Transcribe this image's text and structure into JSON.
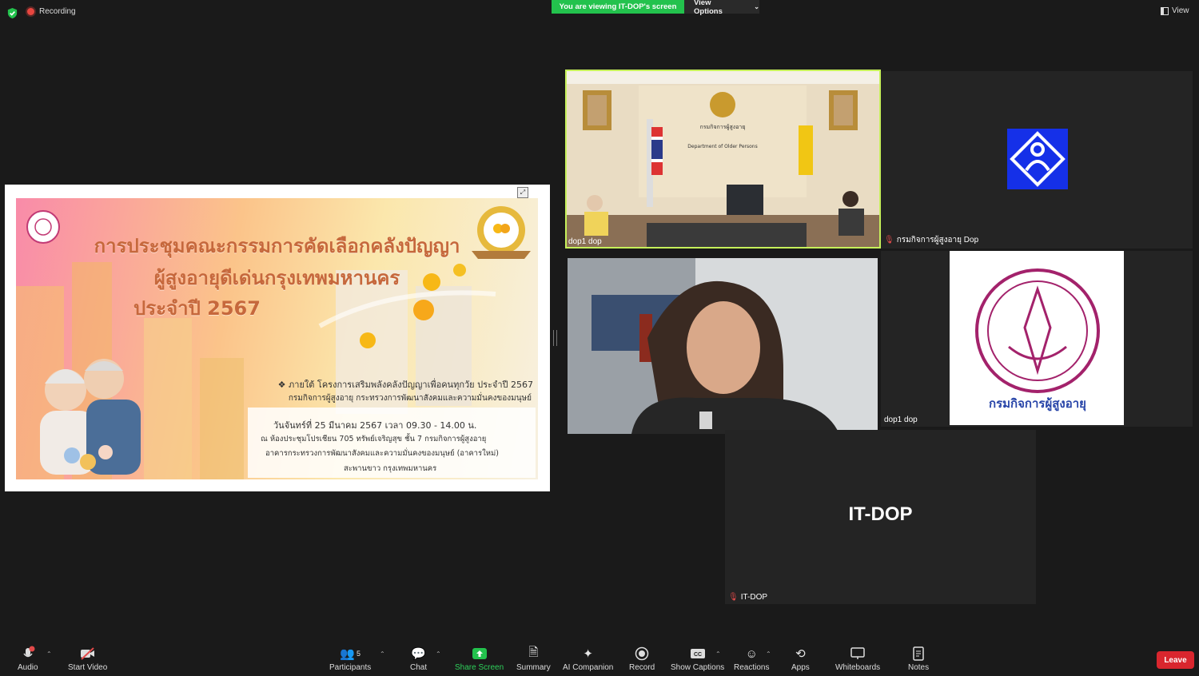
{
  "topbar": {
    "recording_label": "Recording",
    "viewing_banner": "You are viewing IT-DOP's screen",
    "view_options_label": "View Options",
    "view_label": "View"
  },
  "share": {
    "slide": {
      "title_line1": "การประชุมคณะกรรมการคัดเลือกคลังปัญญา",
      "title_line2": "ผู้สูงอายุดีเด่นกรุงเทพมหานคร",
      "title_line3": "ประจำปี 2567",
      "sub_line1": "❖ ภายใต้ โครงการเสริมพลังคลังปัญญาเพื่อคนทุกวัย ประจำปี 2567",
      "sub_line2": "กรมกิจการผู้สูงอายุ กระทรวงการพัฒนาสังคมและความมั่นคงของมนุษย์",
      "date_line": "วันจันทร์ที่ 25 มีนาคม 2567 เวลา 09.30 - 14.00 น.",
      "place_line1": "ณ ห้องประชุมโปรเชียน 705 ทรัพย์เจริญสุข ชั้น 7 กรมกิจการผู้สูงอายุ",
      "place_line2": "อาคารกระทรวงการพัฒนาสังคมและความมั่นคงของมนุษย์ (อาคารใหม่)",
      "place_line3": "สะพานขาว กรุงเทพมหานคร"
    }
  },
  "tiles": {
    "meeting_room_name": "dop1 dop",
    "logo_blue_name": "กรมกิจการผู้สูงอายุ Dop",
    "woman_name": "",
    "seal_name": "dop1 dop",
    "itdop_big": "IT-DOP",
    "itdop_name": "IT-DOP",
    "room_sign_th": "กรมกิจการผู้สูงอายุ",
    "room_sign_en": "Department of Older Persons",
    "seal_text": "กรมกิจการผู้สูงอายุ"
  },
  "toolbar": {
    "audio": "Audio",
    "start_video": "Start Video",
    "participants": "Participants",
    "participants_count": "5",
    "chat": "Chat",
    "share_screen": "Share Screen",
    "summary": "Summary",
    "ai_companion": "AI Companion",
    "record": "Record",
    "show_captions": "Show Captions",
    "reactions": "Reactions",
    "apps": "Apps",
    "whiteboards": "Whiteboards",
    "notes": "Notes",
    "leave": "Leave"
  },
  "colors": {
    "share_green": "#23c24d",
    "leave_red": "#d9262e",
    "active_speaker": "#c6f05a"
  }
}
